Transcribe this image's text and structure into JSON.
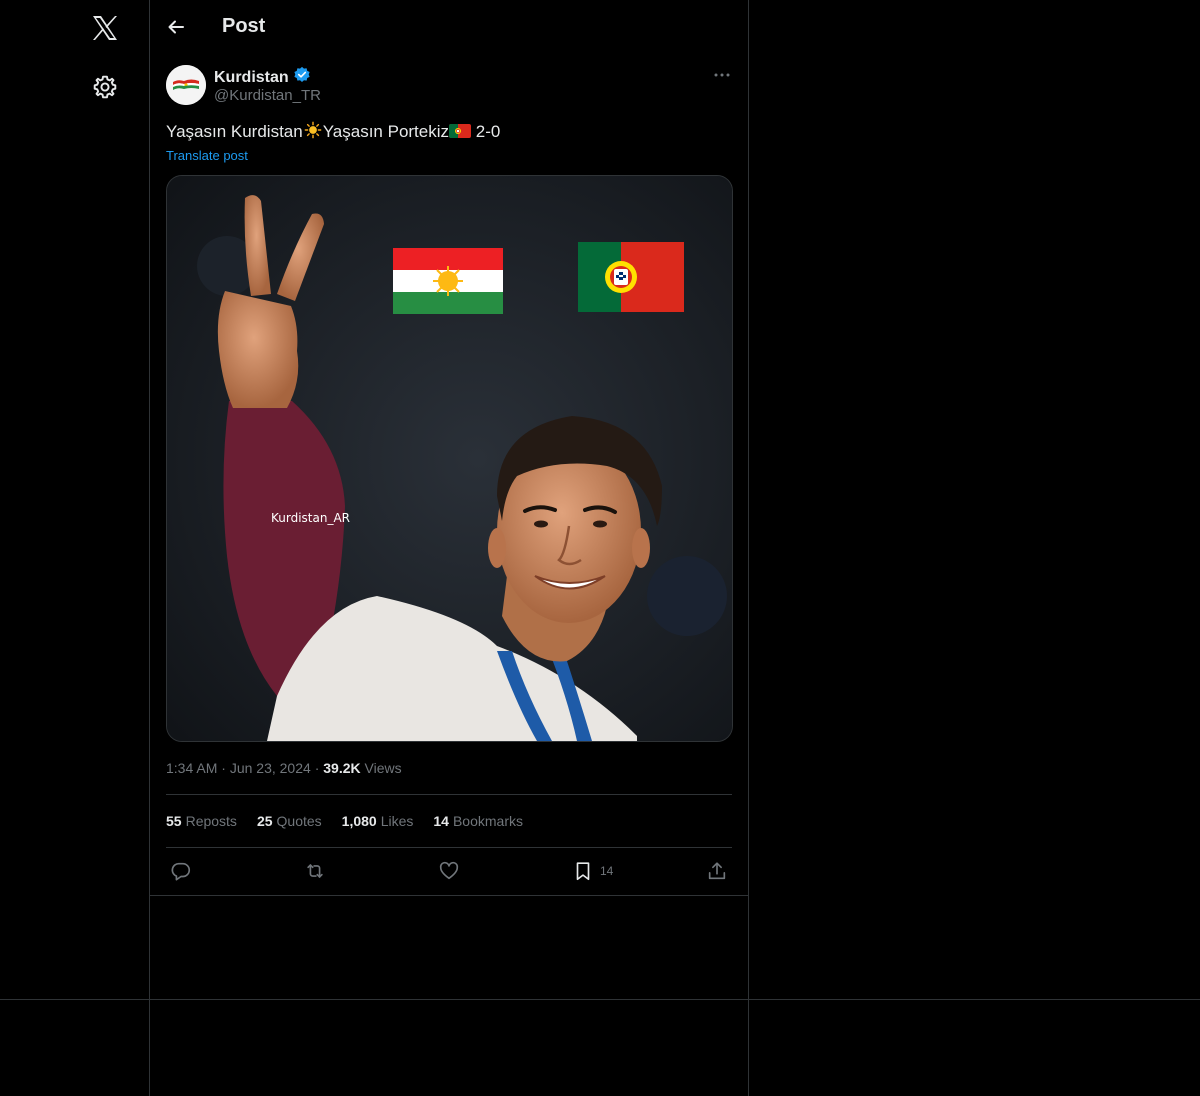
{
  "header": {
    "title": "Post"
  },
  "author": {
    "display_name": "Kurdistan",
    "handle": "@Kurdistan_TR",
    "verified": true
  },
  "post": {
    "text_part1": "Yaşasın Kurdistan",
    "text_part2": "Yaşasın Portekiz",
    "text_part3": " 2-0",
    "translate_label": "Translate post",
    "image_watermark": "Kurdistan_AR"
  },
  "meta": {
    "time": "1:34 AM",
    "date": "Jun 23, 2024",
    "views_count": "39.2K",
    "views_label": "Views",
    "separator": "·"
  },
  "stats": {
    "reposts_count": "55",
    "reposts_label": "Reposts",
    "quotes_count": "25",
    "quotes_label": "Quotes",
    "likes_count": "1,080",
    "likes_label": "Likes",
    "bookmarks_count": "14",
    "bookmarks_label": "Bookmarks"
  },
  "actions": {
    "bookmark_count": "14"
  },
  "colors": {
    "background": "#000000",
    "text": "#e7e9ea",
    "muted": "#71767b",
    "accent": "#1d9bf0",
    "border": "#2f3336"
  },
  "icons": [
    "x-logo-icon",
    "settings-gear-icon",
    "back-arrow-icon",
    "verified-badge-icon",
    "more-options-icon",
    "sun-emoji-icon",
    "portugal-flag-emoji-icon",
    "reply-icon",
    "repost-icon",
    "like-icon",
    "bookmark-icon",
    "share-icon"
  ]
}
